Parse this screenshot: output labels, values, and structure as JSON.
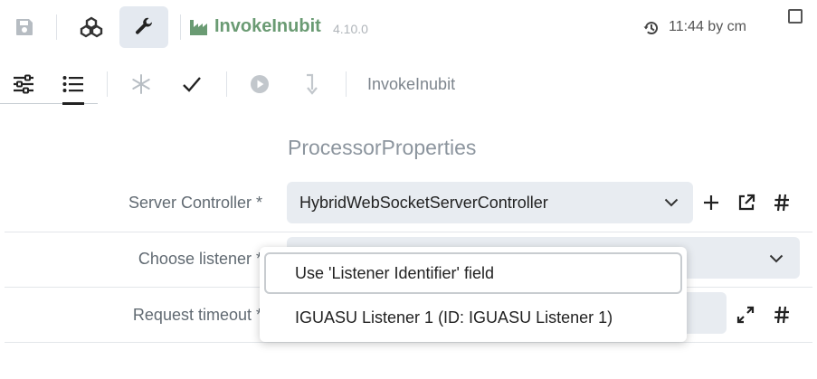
{
  "toolbar": {
    "icons": [
      "save-icon",
      "cluster-icon",
      "wrench-icon",
      "factory-icon"
    ],
    "app_title": "InvokeInubit",
    "version": "4.10.0",
    "timestamp": "11:44 by cm",
    "active_tool": "wrench"
  },
  "subtoolbar": {
    "icons": [
      "sliders-icon",
      "list-icon",
      "asterisk-icon",
      "check-icon",
      "play-circle-icon",
      "step-into-icon"
    ],
    "active_tab": "list",
    "breadcrumb": "InvokeInubit"
  },
  "form": {
    "section_title": "ProcessorProperties",
    "fields": [
      {
        "label": "Server Controller *",
        "value": "HybridWebSocketServerController",
        "actions": [
          "plus-icon",
          "external-link-icon",
          "hash-icon"
        ]
      },
      {
        "label": "Choose listener *",
        "value": ""
      },
      {
        "label": "Request timeout *",
        "value": "",
        "actions": [
          "expand-icon",
          "hash-icon"
        ]
      }
    ]
  },
  "dropdown": {
    "options": [
      "Use 'Listener Identifier' field",
      "IGUASU Listener 1 (ID: IGUASU Listener 1)"
    ],
    "highlighted_index": 0
  },
  "colors": {
    "title_green": "#6a9b73",
    "active_bg": "#e4e9f0",
    "select_bg": "#e8ecf1",
    "label_gray": "#616a72"
  }
}
